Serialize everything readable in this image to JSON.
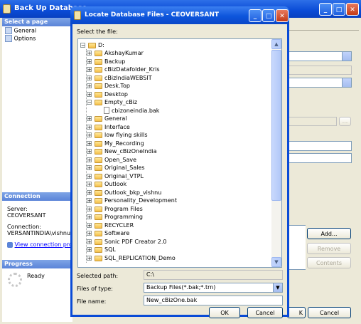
{
  "background_window": {
    "title": "Back Up Database - ",
    "left_pane": {
      "header": "Select a page",
      "pages": [
        "General",
        "Options"
      ],
      "connection_header": "Connection",
      "server_label": "Server:",
      "server_value": "CEOVERSANT",
      "connection_label": "Connection:",
      "connection_value": "VERSANTINDIA\\vishnum",
      "view_link": "View connection prop",
      "progress_header": "Progress",
      "progress_status": "Ready"
    },
    "buttons": {
      "add": "Add...",
      "remove": "Remove",
      "contents": "Contents",
      "ok_partial": "K",
      "cancel": "Cancel"
    }
  },
  "dialog": {
    "title": "Locate Database Files - CEOVERSANT",
    "select_file_label": "Select the file:",
    "root": "D:",
    "folders": [
      {
        "name": "AkshayKumar",
        "type": "folder",
        "level": 1
      },
      {
        "name": "Backup",
        "type": "folder",
        "level": 1
      },
      {
        "name": "cBizDatafolder_Kris",
        "type": "folder",
        "level": 1
      },
      {
        "name": "cBizIndiaWEBSIT",
        "type": "folder",
        "level": 1
      },
      {
        "name": "Desk.Top",
        "type": "folder",
        "level": 1
      },
      {
        "name": "Desktop",
        "type": "folder",
        "level": 1
      },
      {
        "name": "Empty_cBiz",
        "type": "folder",
        "level": 1,
        "expanded": true
      },
      {
        "name": "cbizoneindia.bak",
        "type": "file",
        "level": 2
      },
      {
        "name": "General",
        "type": "folder",
        "level": 1
      },
      {
        "name": "Interface",
        "type": "folder",
        "level": 1
      },
      {
        "name": "low flying skills",
        "type": "folder",
        "level": 1
      },
      {
        "name": "My_Recording",
        "type": "folder",
        "level": 1
      },
      {
        "name": "New_cBizOneIndia",
        "type": "folder",
        "level": 1
      },
      {
        "name": "Open_Save",
        "type": "folder",
        "level": 1
      },
      {
        "name": "Original_Sales",
        "type": "folder",
        "level": 1
      },
      {
        "name": "Original_VTPL",
        "type": "folder",
        "level": 1
      },
      {
        "name": "Outlook",
        "type": "folder",
        "level": 1
      },
      {
        "name": "Outlook_bkp_vishnu",
        "type": "folder",
        "level": 1
      },
      {
        "name": "Personality_Development",
        "type": "folder",
        "level": 1
      },
      {
        "name": "Program Files",
        "type": "folder",
        "level": 1
      },
      {
        "name": "Programming",
        "type": "folder",
        "level": 1
      },
      {
        "name": "RECYCLER",
        "type": "folder",
        "level": 1
      },
      {
        "name": "Software",
        "type": "folder",
        "level": 1
      },
      {
        "name": "Sonic PDF Creator 2.0",
        "type": "folder",
        "level": 1
      },
      {
        "name": "SQL",
        "type": "folder",
        "level": 1
      },
      {
        "name": "SQL_REPLICATION_Demo",
        "type": "folder",
        "level": 1
      }
    ],
    "selected_path_label": "Selected path:",
    "selected_path_value": "C:\\",
    "files_of_type_label": "Files of type:",
    "files_of_type_value": "Backup Files(*.bak;*.trn)",
    "file_name_label": "File name:",
    "file_name_value": "New_cBizOne.bak",
    "ok_label": "OK",
    "cancel_label": "Cancel"
  },
  "colors": {
    "xp_title_blue": "#0a4bd6",
    "dialog_face": "#ece9d8",
    "link_blue": "#0000ff"
  }
}
